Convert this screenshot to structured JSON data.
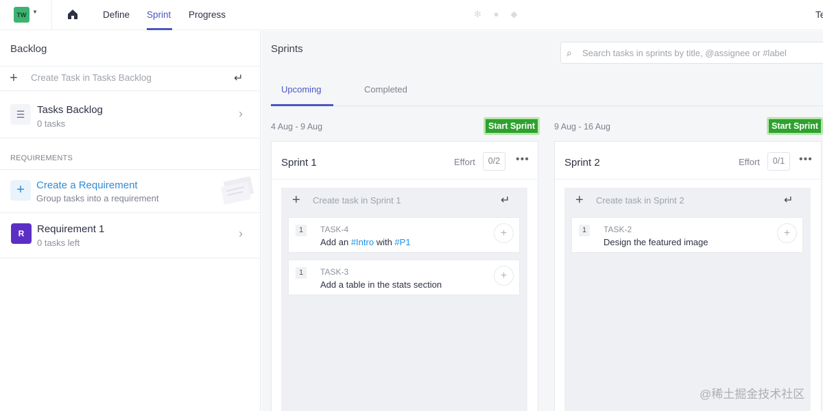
{
  "topbar": {
    "workspace_initials": "TW",
    "nav": [
      "Define",
      "Sprint",
      "Progress"
    ],
    "active_nav": "Sprint",
    "user_cut": "Te"
  },
  "left": {
    "title": "Backlog",
    "create_task_placeholder": "Create Task in Tasks Backlog",
    "backlog": {
      "title": "Tasks Backlog",
      "count": "0 tasks"
    },
    "requirements_header": "REQUIREMENTS",
    "create_requirement": {
      "title": "Create a Requirement",
      "subtitle": "Group tasks into a requirement"
    },
    "requirement": {
      "badge": "R",
      "title": "Requirement 1",
      "sub": "0 tasks left"
    }
  },
  "main": {
    "title": "Sprints",
    "search_placeholder": "Search tasks in sprints by title, @assignee or #label",
    "tabs": [
      "Upcoming",
      "Completed"
    ],
    "active_tab": "Upcoming",
    "sprints": [
      {
        "range": "4 Aug - 9 Aug",
        "start_label": "Start Sprint",
        "title": "Sprint 1",
        "effort_label": "Effort",
        "effort": "0/2",
        "create_placeholder": "Create task in Sprint 1",
        "tasks": [
          {
            "num": "1",
            "id": "TASK-4",
            "parts": [
              "Add an ",
              "#Intro",
              " with ",
              "#P1"
            ]
          },
          {
            "num": "1",
            "id": "TASK-3",
            "parts": [
              "Add a table in the stats section"
            ]
          }
        ]
      },
      {
        "range": "9 Aug - 16 Aug",
        "start_label": "Start Sprint",
        "title": "Sprint 2",
        "effort_label": "Effort",
        "effort": "0/1",
        "create_placeholder": "Create task in Sprint 2",
        "tasks": [
          {
            "num": "1",
            "id": "TASK-2",
            "parts": [
              "Design the featured image"
            ]
          }
        ]
      }
    ]
  },
  "watermark": "@稀土掘金技术社区",
  "colors": {
    "accent": "#4a56c4",
    "start_button": "#2ea12e",
    "link": "#2e8bd6",
    "tag": "#1e90e6",
    "requirement_badge": "#5b2fc4"
  }
}
